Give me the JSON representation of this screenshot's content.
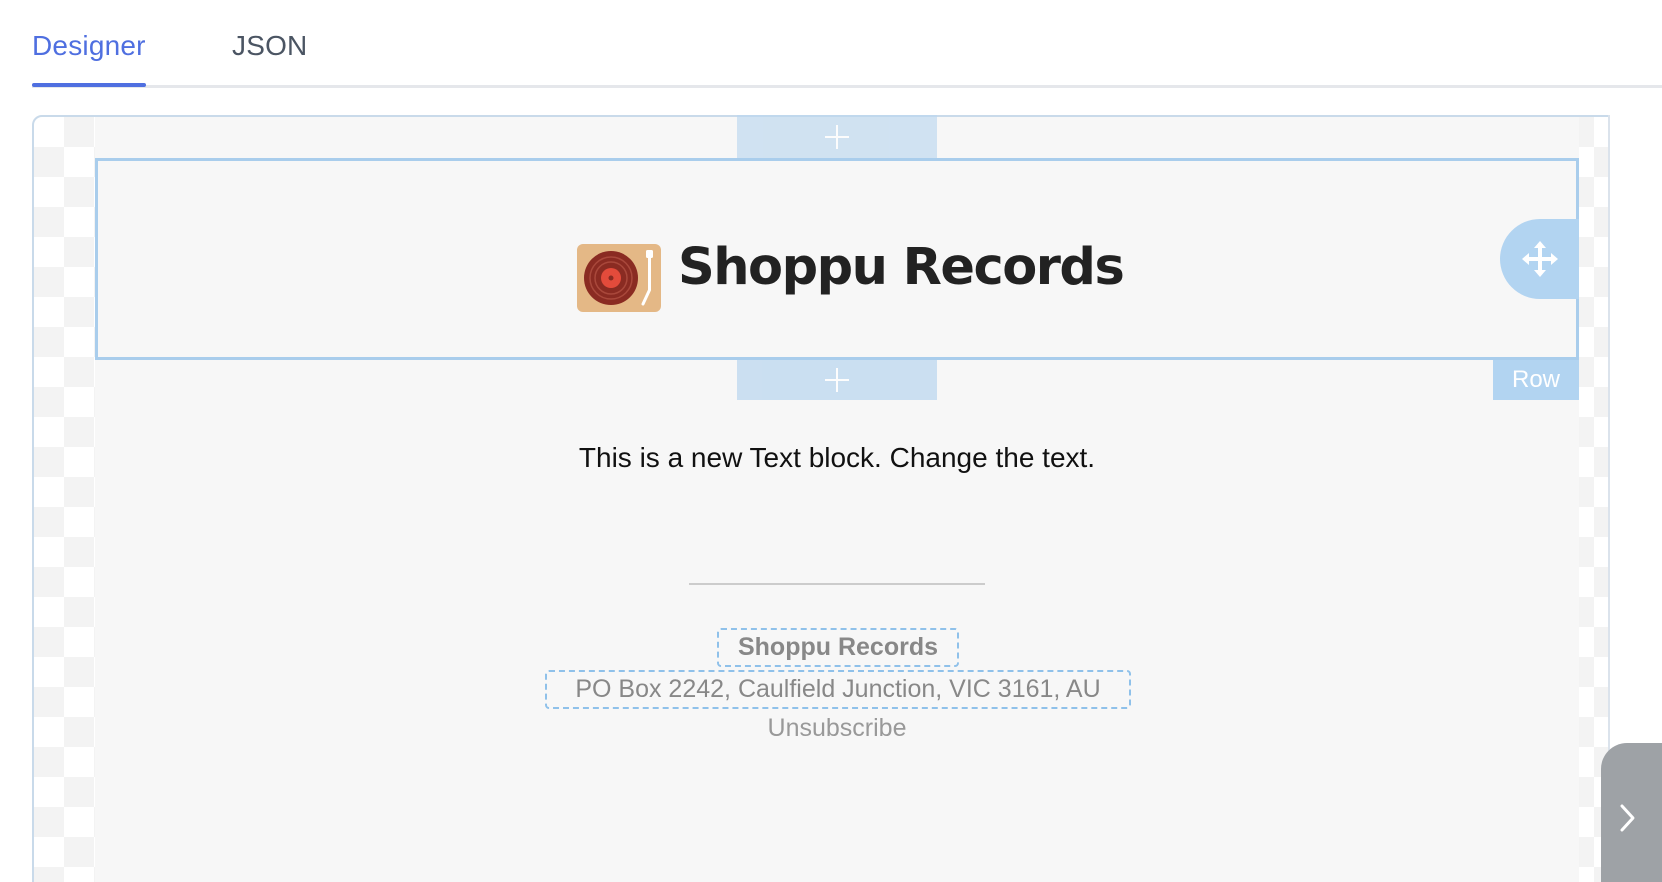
{
  "tabs": {
    "designer_label": "Designer",
    "json_label": "JSON"
  },
  "row": {
    "label": "Row"
  },
  "header": {
    "brand_name": "Shoppu Records"
  },
  "content": {
    "text_block": "This is a new Text block. Change the text."
  },
  "footer": {
    "company": "Shoppu Records",
    "address": "PO Box 2242, Caulfield Junction, VIC 3161, AU",
    "unsubscribe": "Unsubscribe"
  },
  "icons": {
    "add_top": "plus-icon",
    "add_bottom": "plus-icon",
    "move": "move-arrows-icon",
    "logo": "turntable-icon",
    "sidebar_toggle": "chevron-right-icon"
  },
  "colors": {
    "accent": "#4f6fe0",
    "selection": "#a9cdec",
    "email_background": "#f7f7f7"
  }
}
